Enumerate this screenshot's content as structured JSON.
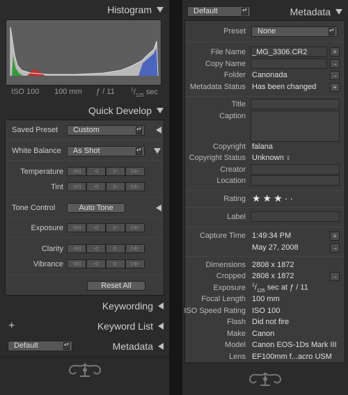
{
  "left": {
    "histogram": {
      "title": "Histogram",
      "iso": "ISO 100",
      "focal": "100 mm",
      "aperture": "ƒ / 11",
      "shutter_num": "1",
      "shutter_den": "125",
      "shutter_unit": "sec"
    },
    "quick_develop": {
      "title": "Quick Develop",
      "saved_preset_label": "Saved Preset",
      "saved_preset_value": "Custom",
      "white_balance_label": "White Balance",
      "white_balance_value": "As Shot",
      "temperature_label": "Temperature",
      "tint_label": "Tint",
      "tone_control_label": "Tone Control",
      "auto_tone_label": "Auto Tone",
      "exposure_label": "Exposure",
      "clarity_label": "Clarity",
      "vibrance_label": "Vibrance",
      "reset_all_label": "Reset All",
      "step_glyphs": [
        "◁◁",
        "◁",
        "▷",
        "▷▷"
      ]
    },
    "keywording": {
      "title": "Keywording"
    },
    "keyword_list": {
      "title": "Keyword List",
      "add_glyph": "+"
    },
    "metadata": {
      "title": "Metadata",
      "preset_value": "Default"
    }
  },
  "right": {
    "header": {
      "title": "Metadata",
      "preset_value": "Default"
    },
    "preset_label": "Preset",
    "preset_value": "None",
    "file_name_label": "File Name",
    "file_name_value": "_MG_3306.CR2",
    "copy_name_label": "Copy Name",
    "folder_label": "Folder",
    "folder_value": "Canonada",
    "metadata_status_label": "Metadata Status",
    "metadata_status_value": "Has been changed",
    "title_label": "Title",
    "caption_label": "Caption",
    "copyright_label": "Copyright",
    "copyright_value": "falana",
    "copyright_status_label": "Copyright Status",
    "copyright_status_value": "Unknown",
    "creator_label": "Creator",
    "location_label": "Location",
    "rating_label": "Rating",
    "rating_value": 3,
    "rating_max": 5,
    "label_label": "Label",
    "capture_time_label": "Capture Time",
    "capture_time_value": "1:49:34 PM",
    "capture_date_value": "May 27, 2008",
    "dimensions_label": "Dimensions",
    "dimensions_value": "2808 x 1872",
    "cropped_label": "Cropped",
    "cropped_value": "2808 x 1872",
    "exposure_label": "Exposure",
    "exposure_num": "1",
    "exposure_den": "125",
    "exposure_rest": "sec at ƒ / 11",
    "focal_length_label": "Focal Length",
    "focal_length_value": "100 mm",
    "iso_label": "ISO Speed Rating",
    "iso_value": "ISO 100",
    "flash_label": "Flash",
    "flash_value": "Did not fire",
    "make_label": "Make",
    "make_value": "Canon",
    "model_label": "Model",
    "model_value": "Canon EOS-1Ds Mark III",
    "lens_label": "Lens",
    "lens_value": "EF100mm f...acro USM"
  },
  "colors": {
    "panel": "#2b2b2b",
    "box": "#3b3b3b",
    "separator": "#161616"
  }
}
